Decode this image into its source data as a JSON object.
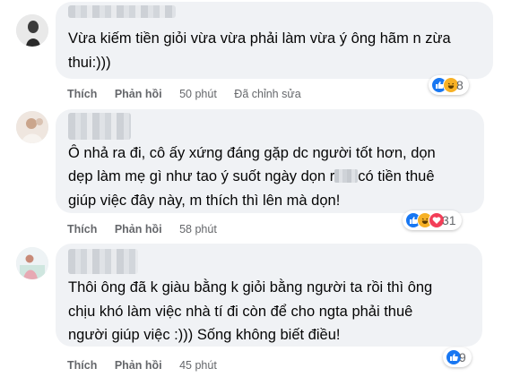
{
  "comments": [
    {
      "text_lines": [
        "Vừa kiếm tiền giỏi vừa vừa phải làm vừa ý ông hãm n zừa",
        "thui:)))"
      ],
      "like_label": "Thích",
      "reply_label": "Phản hồi",
      "time": "50 phút",
      "edited": "Đã chỉnh sửa",
      "reaction_count": "8",
      "reactions": [
        "like-icon",
        "haha-icon"
      ]
    },
    {
      "text_line1": "Ô nhả ra đi, cô ấy xứng đáng gặp dc người tốt hơn, dọn",
      "text_line2_a": "dẹp làm mẹ gì như tao ý suốt ngày dọn r",
      "text_line2_b": "có tiền thuê",
      "text_line3": "giúp việc đây này, m thích thì lên mà dọn!",
      "like_label": "Thích",
      "reply_label": "Phản hồi",
      "time": "58 phút",
      "reaction_count": "31",
      "reactions": [
        "like-icon",
        "haha-icon",
        "love-icon"
      ]
    },
    {
      "text_lines": [
        "Thôi ông đã k giàu bằng k giỏi bằng người ta rồi thì ông",
        "chịu khó làm việc nhà tí đi còn để cho ngta phải thuê",
        "người giúp việc :))) Sống không biết điều!"
      ],
      "like_label": "Thích",
      "reply_label": "Phản hồi",
      "time": "45 phút",
      "reaction_count": "9",
      "reactions": [
        "like-icon"
      ]
    }
  ],
  "colors": {
    "bubble": "#f0f2f5",
    "meta": "#65676b",
    "like": "#1877f2",
    "haha": "#f7b125",
    "love": "#f33e58"
  }
}
